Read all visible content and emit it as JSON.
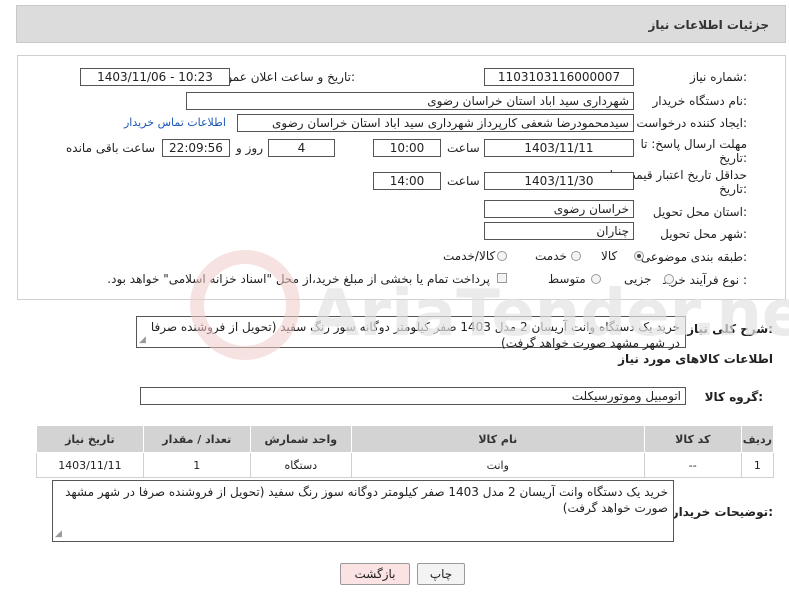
{
  "header": {
    "title": "جزئیات اطلاعات نیاز"
  },
  "form": {
    "need_number": {
      "label": "شماره نیاز:",
      "value": "1103103116000007"
    },
    "announce_datetime": {
      "label": "تاریخ و ساعت اعلان عمومی:",
      "value": "1403/11/06 - 10:23"
    },
    "buyer_org": {
      "label": "نام دستگاه خریدار:",
      "value": "شهرداری سید اباد استان خراسان رضوی"
    },
    "requester": {
      "label": "ایجاد کننده درخواست:",
      "value": "سیدمحمودرضا شعفی کارپرداز شهرداری سید اباد استان خراسان رضوی"
    },
    "buyer_contact_link": "اطلاعات تماس خریدار",
    "reply_deadline": {
      "label_line1": "مهلت ارسال پاسخ: تا",
      "label_line2": "تاریخ:",
      "date": "1403/11/11",
      "time_label": "ساعت",
      "time": "10:00",
      "days": "4",
      "days_label": "روز و",
      "remaining": "22:09:56",
      "remaining_label": "ساعت باقی مانده"
    },
    "price_validity": {
      "label_line1": "حداقل تاریخ اعتبار قیمت: تا",
      "label_line2": "تاریخ:",
      "date": "1403/11/30",
      "time_label": "ساعت",
      "time": "14:00"
    },
    "delivery_province": {
      "label": "استان محل تحویل:",
      "value": "خراسان رضوی"
    },
    "delivery_city": {
      "label": "شهر محل تحویل:",
      "value": "چناران"
    },
    "category": {
      "label": "طبقه بندی موضوعی:",
      "options": [
        "کالا",
        "خدمت",
        "کالا/خدمت"
      ],
      "selected": "کالا"
    },
    "purchase_type": {
      "label": "نوع فرآیند خرید :",
      "options": [
        "جزیی",
        "متوسط"
      ],
      "payment_note": "پرداخت تمام یا بخشی از مبلغ خرید،از محل \"اسناد خزانه اسلامی\" خواهد بود."
    }
  },
  "summary": {
    "label": "شرح کلی نیاز:",
    "text": "خرید یک دستگاه وانت آریسان 2 مدل 1403 صفر کیلومتر دوگانه سوز رنگ سفید (تحویل از فروشنده صرفا در شهر مشهد صورت خواهد گرفت)"
  },
  "goods_section": {
    "title": "اطلاعات کالاهای مورد نیاز",
    "group_label": "گروه کالا:",
    "group_value": "اتومبیل وموتورسیکلت"
  },
  "items_table": {
    "headers": [
      "ردیف",
      "کد کالا",
      "نام کالا",
      "واحد شمارش",
      "تعداد / مقدار",
      "تاریخ نیاز"
    ],
    "rows": [
      [
        "1",
        "--",
        "وانت",
        "دستگاه",
        "1",
        "1403/11/11"
      ]
    ]
  },
  "buyer_notes": {
    "label": "توضیحات خریدار:",
    "text": "خرید یک دستگاه وانت آریسان 2 مدل 1403 صفر کیلومتر دوگانه سوز رنگ سفید (تحویل از فروشنده صرفا در شهر مشهد صورت خواهد گرفت)"
  },
  "buttons": {
    "print": "چاپ",
    "back": "بازگشت"
  },
  "watermark": {
    "text": "AriaTender.neT"
  },
  "colors": {
    "header_bg": "#dcdcdc",
    "table_header_bg": "#d3d3d3",
    "link": "#1a56b8",
    "back_button_bg": "#fbe3e3"
  }
}
